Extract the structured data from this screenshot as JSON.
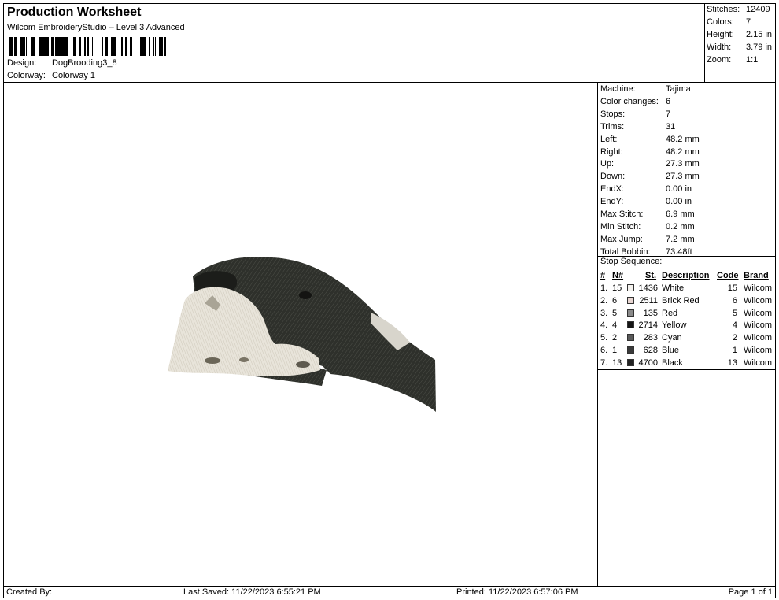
{
  "header": {
    "title": "Production Worksheet",
    "subtitle": "Wilcom EmbroideryStudio – Level 3 Advanced",
    "design_label": "Design:",
    "design_value": "DogBrooding3_8",
    "colorway_label": "Colorway:",
    "colorway_value": "Colorway 1"
  },
  "summary": {
    "stitches_label": "Stitches:",
    "stitches_value": "12409",
    "colors_label": "Colors:",
    "colors_value": "7",
    "height_label": "Height:",
    "height_value": "2.15 in",
    "width_label": "Width:",
    "width_value": "3.79 in",
    "zoom_label": "Zoom:",
    "zoom_value": "1:1"
  },
  "machine": [
    {
      "label": "Machine:",
      "value": "Tajima"
    },
    {
      "label": "Color changes:",
      "value": "6"
    },
    {
      "label": "Stops:",
      "value": "7"
    },
    {
      "label": "Trims:",
      "value": "31"
    },
    {
      "label": "Left:",
      "value": "48.2 mm"
    },
    {
      "label": "Right:",
      "value": "48.2 mm"
    },
    {
      "label": "Up:",
      "value": "27.3 mm"
    },
    {
      "label": "Down:",
      "value": "27.3 mm"
    },
    {
      "label": "EndX:",
      "value": "0.00 in"
    },
    {
      "label": "EndY:",
      "value": "0.00 in"
    },
    {
      "label": "Max Stitch:",
      "value": "6.9 mm"
    },
    {
      "label": "Min Stitch:",
      "value": "0.2 mm"
    },
    {
      "label": "Max Jump:",
      "value": "7.2 mm"
    },
    {
      "label": "Total Bobbin:",
      "value": "73.48ft"
    }
  ],
  "sequence": {
    "title": "Stop Sequence:",
    "headers": {
      "num": "#",
      "n": "N#",
      "st": "St.",
      "desc": "Description",
      "code": "Code",
      "brand": "Brand"
    },
    "rows": [
      {
        "num": "1.",
        "n": "15",
        "color": "#f4f2ee",
        "st": "1436",
        "desc": "White",
        "code": "15",
        "brand": "Wilcom"
      },
      {
        "num": "2.",
        "n": "6",
        "color": "#e8d6d2",
        "st": "2511",
        "desc": "Brick Red",
        "code": "6",
        "brand": "Wilcom"
      },
      {
        "num": "3.",
        "n": "5",
        "color": "#8a8a8a",
        "st": "135",
        "desc": "Red",
        "code": "5",
        "brand": "Wilcom"
      },
      {
        "num": "4.",
        "n": "4",
        "color": "#151515",
        "st": "2714",
        "desc": "Yellow",
        "code": "4",
        "brand": "Wilcom"
      },
      {
        "num": "5.",
        "n": "2",
        "color": "#5a5a5a",
        "st": "283",
        "desc": "Cyan",
        "code": "2",
        "brand": "Wilcom"
      },
      {
        "num": "6.",
        "n": "1",
        "color": "#3a3a3a",
        "st": "628",
        "desc": "Blue",
        "code": "1",
        "brand": "Wilcom"
      },
      {
        "num": "7.",
        "n": "13",
        "color": "#222222",
        "st": "4700",
        "desc": "Black",
        "code": "13",
        "brand": "Wilcom"
      }
    ]
  },
  "footer": {
    "created_by": "Created By:",
    "last_saved": "Last Saved: 11/22/2023 6:55:21 PM",
    "printed": "Printed: 11/22/2023 6:57:06 PM",
    "page": "Page 1 of 1"
  }
}
